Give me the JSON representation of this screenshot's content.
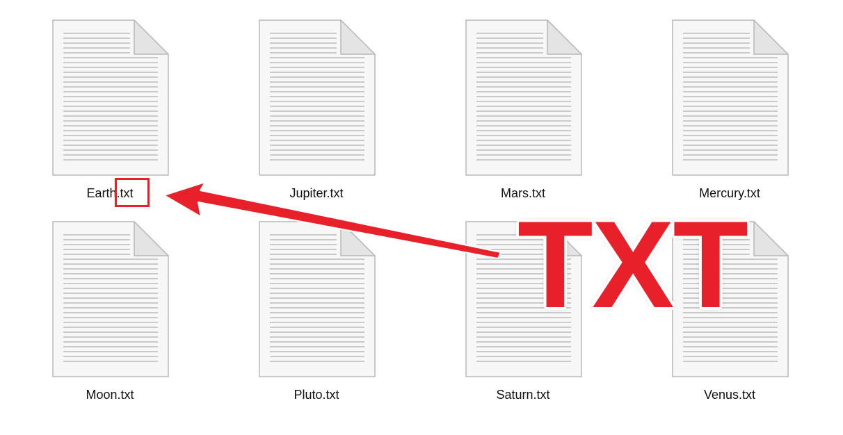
{
  "files": [
    {
      "name": "Earth.txt"
    },
    {
      "name": "Jupiter.txt"
    },
    {
      "name": "Mars.txt"
    },
    {
      "name": "Mercury.txt"
    },
    {
      "name": "Moon.txt"
    },
    {
      "name": "Pluto.txt"
    },
    {
      "name": "Saturn.txt"
    },
    {
      "name": "Venus.txt"
    }
  ],
  "file_icon": "text-document-icon",
  "annotation": {
    "overlay_text": "TXT",
    "highlight_color": "#e8202a",
    "arrow_icon": "arrow-left-icon"
  }
}
